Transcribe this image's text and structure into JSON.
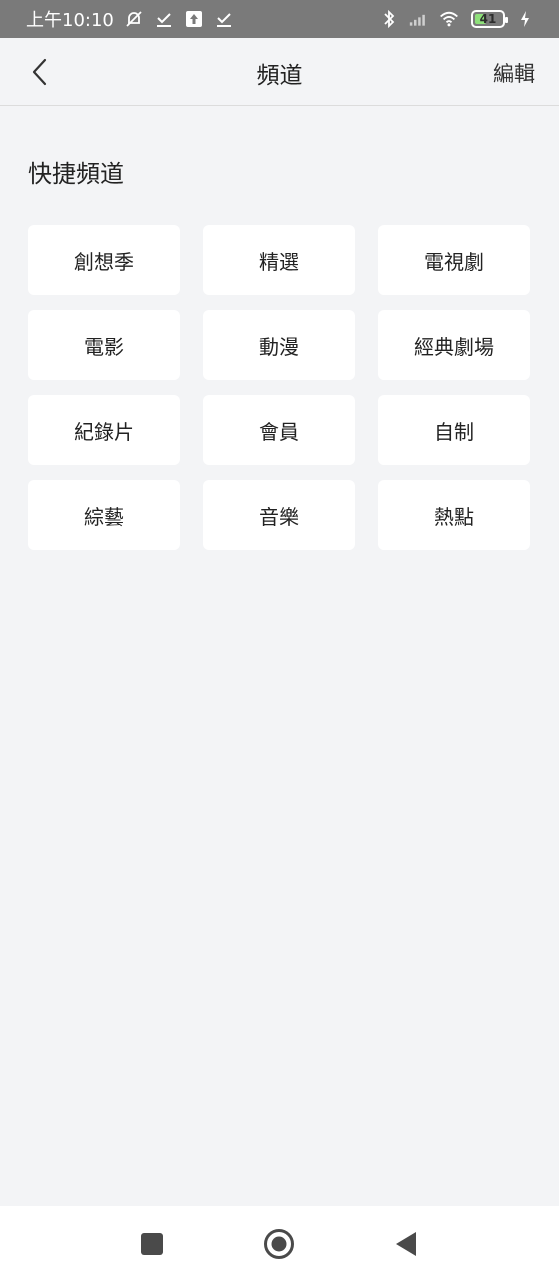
{
  "status_bar": {
    "time": "上午10:10",
    "battery_level": "41",
    "battery_fraction": 0.41,
    "icons": [
      "mute-alarm-icon",
      "download-check-icon",
      "upload-icon",
      "download-check-icon",
      "bluetooth-icon",
      "signal-icon",
      "wifi-icon",
      "battery-icon",
      "charging-icon"
    ]
  },
  "header": {
    "title": "頻道",
    "edit_label": "編輯"
  },
  "section": {
    "title": "快捷頻道",
    "channels": [
      {
        "label": "創想季"
      },
      {
        "label": "精選"
      },
      {
        "label": "電視劇"
      },
      {
        "label": "電影"
      },
      {
        "label": "動漫"
      },
      {
        "label": "經典劇場"
      },
      {
        "label": "紀錄片"
      },
      {
        "label": "會員"
      },
      {
        "label": "自制"
      },
      {
        "label": "綜藝"
      },
      {
        "label": "音樂"
      },
      {
        "label": "熱點"
      }
    ]
  },
  "nav_bar": {
    "buttons": [
      "recents-square-icon",
      "home-circle-icon",
      "back-triangle-icon"
    ]
  },
  "colors": {
    "background": "#f3f4f6",
    "status_bar": "#7a7a7a",
    "chip_background": "#ffffff",
    "text": "#222222"
  }
}
